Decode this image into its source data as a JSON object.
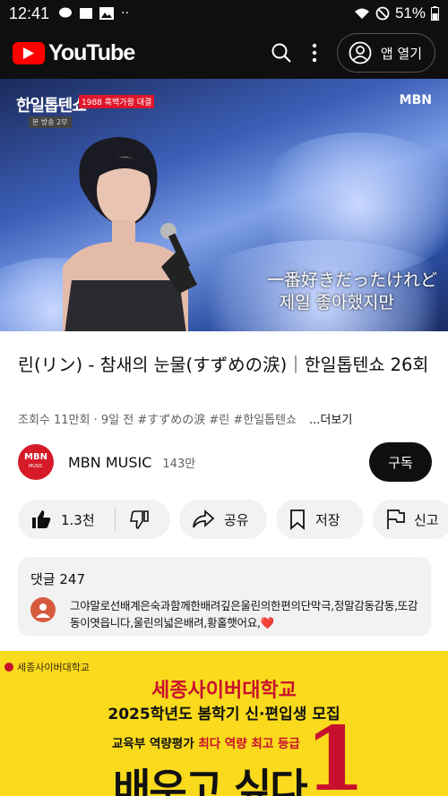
{
  "status_bar": {
    "time": "12:41",
    "battery": "51%"
  },
  "header": {
    "logo_text": "YouTube",
    "open_app_label": "앱 열기"
  },
  "player": {
    "show_name": "한일톱텐쇼",
    "show_tag": "1988 흑백가왕 대결",
    "episode_tag": "본 방송 2부",
    "network_logo": "MBN",
    "subtitle_line1": "一番好きだったけれど",
    "subtitle_line2": "제일 좋아했지만"
  },
  "video": {
    "title": "린(リン) - 참새의 눈물(すずめの涙)｜한일톱텐쇼 26회",
    "meta": "조회수 11만회 · 9일 전  #すずめの涙 #린 #한일톱텐쇼",
    "more_label": "...더보기"
  },
  "channel": {
    "avatar_text": "MBN",
    "avatar_sub": "MUSIC",
    "name": "MBN MUSIC",
    "subscribers": "143만",
    "subscribe_label": "구독"
  },
  "actions": {
    "like_count": "1.3천",
    "share_label": "공유",
    "save_label": "저장",
    "report_label": "신고"
  },
  "comments": {
    "header": "댓글 247",
    "top_comment": "그야말로선배계은숙과함께한배려깊은울린의한편의단막극,정말감동감동,또감동이엿읍니다,울린의넓은배려,황홀햇어요,❤️"
  },
  "ad": {
    "brand": "세종사이버대학교",
    "headline": "세종사이버대학교",
    "subheadline": "2025학년도 봄학기 신·편입생 모집",
    "tagline_prefix": "교육부 역량평가",
    "tagline_highlight": "최다 역량 최고 등급",
    "big_text": "배우고 싶다",
    "rank": "1"
  },
  "colors": {
    "brand_red": "#ff0000",
    "ad_yellow": "#f9da1c",
    "ad_red": "#c8102e"
  }
}
